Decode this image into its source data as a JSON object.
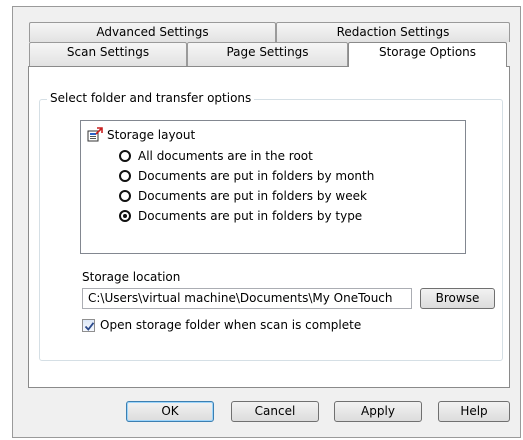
{
  "tabs": {
    "back_row": [
      "Advanced Settings",
      "Redaction Settings"
    ],
    "front_row": [
      "Scan Settings",
      "Page Settings",
      "Storage Options"
    ],
    "active": "Storage Options"
  },
  "group": {
    "legend": "Select folder and transfer options"
  },
  "storage_layout": {
    "title": "Storage layout",
    "options": [
      {
        "label": "All documents are in the root",
        "checked": false
      },
      {
        "label": "Documents are put in folders by month",
        "checked": false
      },
      {
        "label": "Documents are put in folders by week",
        "checked": false
      },
      {
        "label": "Documents are put in folders by type",
        "checked": true
      }
    ]
  },
  "storage_location": {
    "label": "Storage location",
    "path": "C:\\Users\\virtual machine\\Documents\\My OneTouch",
    "browse_label": "Browse"
  },
  "open_folder": {
    "label": "Open storage folder when scan is complete",
    "checked": true
  },
  "buttons": {
    "ok": "OK",
    "cancel": "Cancel",
    "apply": "Apply",
    "help": "Help"
  },
  "colors": {
    "dialog_bg": "#f0f0f0",
    "default_button_border": "#3c7fb1"
  }
}
